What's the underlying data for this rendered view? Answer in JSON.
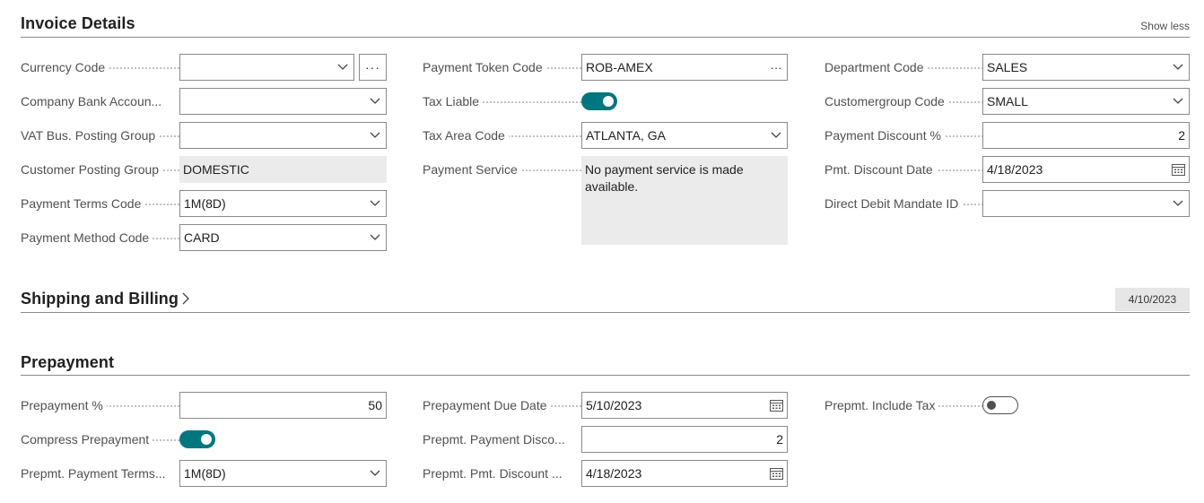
{
  "invoice": {
    "title": "Invoice Details",
    "show_less": "Show less",
    "currency_code": {
      "label": "Currency Code",
      "value": ""
    },
    "company_bank": {
      "label": "Company Bank Accoun...",
      "value": ""
    },
    "vat_bus": {
      "label": "VAT Bus. Posting Group",
      "value": ""
    },
    "customer_posting": {
      "label": "Customer Posting Group",
      "value": "DOMESTIC"
    },
    "payment_terms": {
      "label": "Payment Terms Code",
      "value": "1M(8D)"
    },
    "payment_method": {
      "label": "Payment Method Code",
      "value": "CARD"
    },
    "payment_token": {
      "label": "Payment Token Code",
      "value": "ROB-AMEX"
    },
    "tax_liable": {
      "label": "Tax Liable",
      "value": true
    },
    "tax_area": {
      "label": "Tax Area Code",
      "value": "ATLANTA, GA"
    },
    "payment_service": {
      "label": "Payment Service",
      "value": "No payment service is made available."
    },
    "department": {
      "label": "Department Code",
      "value": "SALES"
    },
    "customergroup": {
      "label": "Customergroup Code",
      "value": "SMALL"
    },
    "payment_discount": {
      "label": "Payment Discount %",
      "value": "2"
    },
    "pmt_discount_date": {
      "label": "Pmt. Discount Date",
      "value": "4/18/2023"
    },
    "direct_debit": {
      "label": "Direct Debit Mandate ID",
      "value": ""
    }
  },
  "shipping": {
    "title": "Shipping and Billing",
    "badge": "4/10/2023"
  },
  "prepayment": {
    "title": "Prepayment",
    "prepayment_pct": {
      "label": "Prepayment %",
      "value": "50"
    },
    "compress": {
      "label": "Compress Prepayment",
      "value": true
    },
    "prepmt_terms": {
      "label": "Prepmt. Payment Terms...",
      "value": "1M(8D)"
    },
    "due_date": {
      "label": "Prepayment Due Date",
      "value": "5/10/2023"
    },
    "pmt_disco": {
      "label": "Prepmt. Payment Disco...",
      "value": "2"
    },
    "pmt_discount": {
      "label": "Prepmt. Pmt. Discount ...",
      "value": "4/18/2023"
    },
    "include_tax": {
      "label": "Prepmt. Include Tax",
      "value": false
    }
  },
  "icons": {
    "dropdown": "chevron-down-icon",
    "calendar": "calendar-icon",
    "assist": "ellipsis-icon",
    "expand": "chevron-right-icon"
  },
  "colors": {
    "accent": "#00767f",
    "readonly_bg": "#ebebeb",
    "border": "#8a8a8a"
  }
}
